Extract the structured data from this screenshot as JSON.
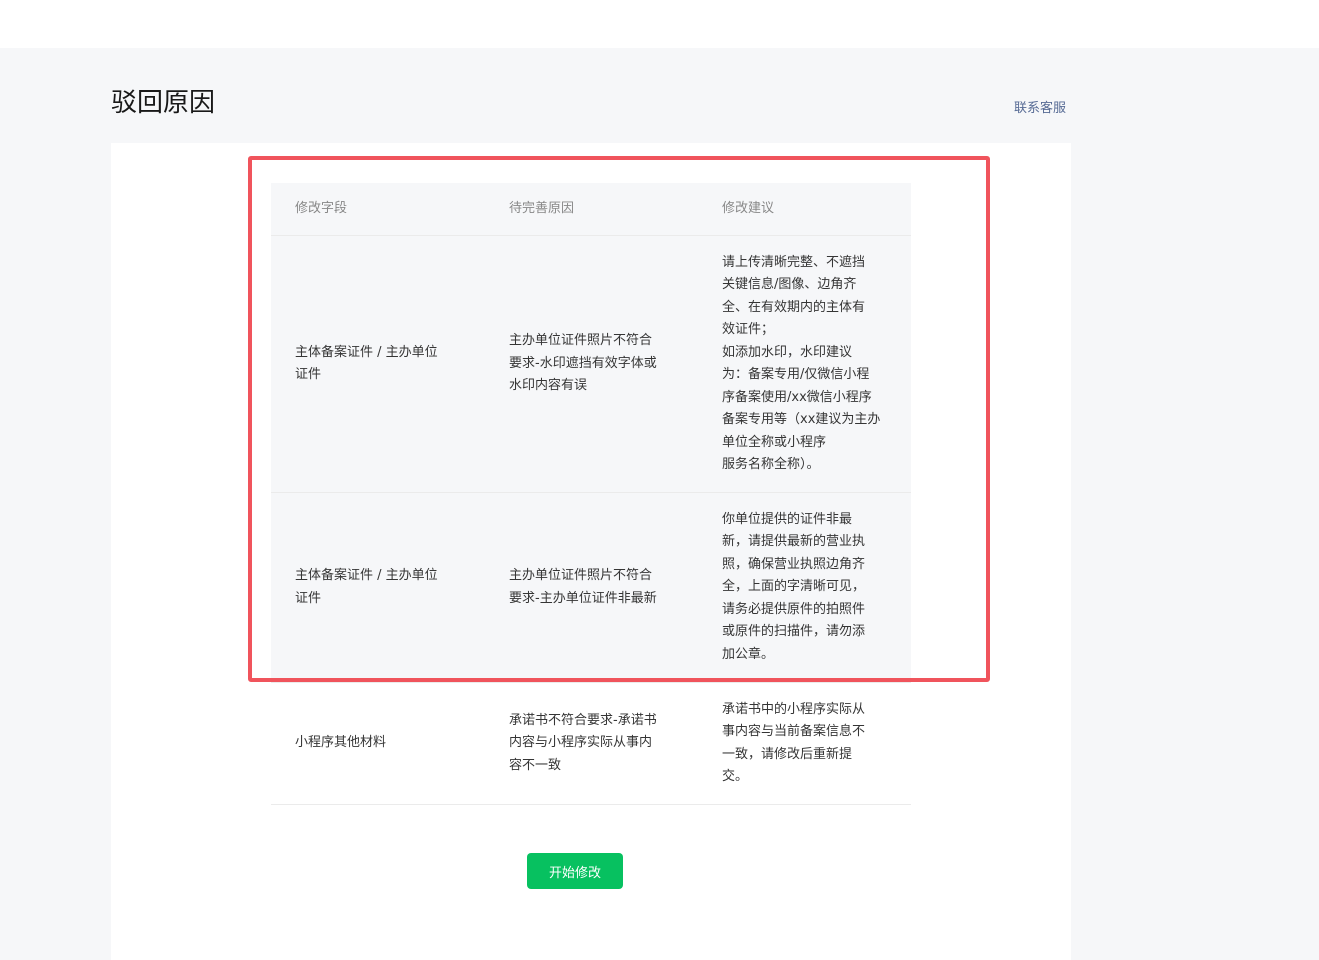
{
  "page": {
    "title": "驳回原因",
    "contact_link": "联系客服"
  },
  "table": {
    "headers": [
      "修改字段",
      "待完善原因",
      "修改建议"
    ],
    "rows": [
      {
        "field": "主体备案证件 / 主办单位\n证件",
        "reason": "主办单位证件照片不符合\n要求-水印遮挡有效字体或\n水印内容有误",
        "suggestion": "请上传清晰完整、不遮挡\n关键信息/图像、边角齐\n全、在有效期内的主体有\n效证件；\n如添加水印，水印建议\n为：备案专用/仅微信小程\n序备案使用/xx微信小程序\n备案专用等（xx建议为主办\n单位全称或小程序\n服务名称全称）。"
      },
      {
        "field": "主体备案证件 / 主办单位\n证件",
        "reason": "主办单位证件照片不符合\n要求-主办单位证件非最新",
        "suggestion": "你单位提供的证件非最\n新，请提供最新的营业执\n照，确保营业执照边角齐\n全，上面的字清晰可见，\n请务必提供原件的拍照件\n或原件的扫描件，请勿添\n加公章。"
      },
      {
        "field": "小程序其他材料",
        "reason": "承诺书不符合要求-承诺书\n内容与小程序实际从事内\n容不一致",
        "suggestion": "承诺书中的小程序实际从\n事内容与当前备案信息不\n一致，请修改后重新提\n交。"
      }
    ]
  },
  "actions": {
    "start_edit_label": "开始修改"
  },
  "colors": {
    "accent_green": "#07c160",
    "highlight_red": "#f0545c",
    "link_blue": "#576b95"
  }
}
